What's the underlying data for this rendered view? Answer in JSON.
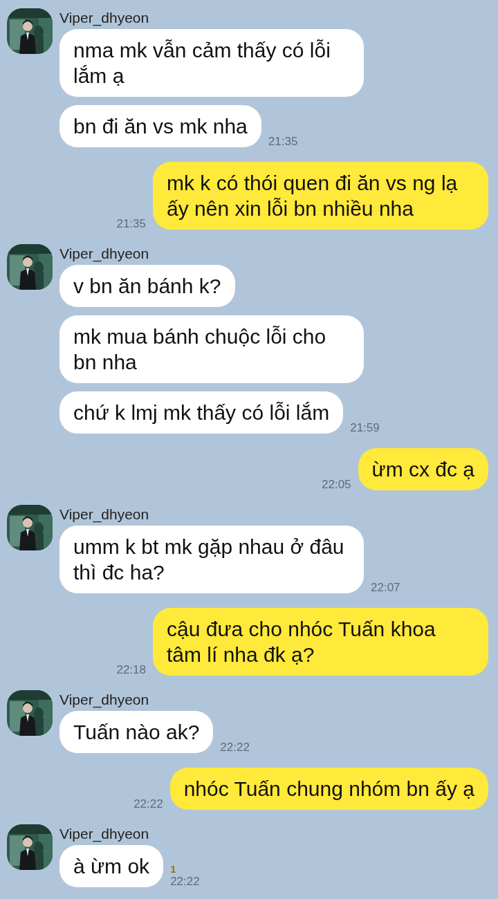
{
  "messages": [
    {
      "kind": "received",
      "sender": "Viper_dhyeon",
      "bubbles": [
        {
          "text": "nma mk vẫn cảm thấy có lỗi lắm ạ"
        },
        {
          "text": "bn đi ăn vs mk nha",
          "time": "21:35"
        }
      ]
    },
    {
      "kind": "sent",
      "bubbles": [
        {
          "text": "mk k có thói quen đi ăn vs ng lạ ấy nên xin lỗi bn nhiều nha",
          "time": "21:35"
        }
      ]
    },
    {
      "kind": "received",
      "sender": "Viper_dhyeon",
      "bubbles": [
        {
          "text": "v bn ăn bánh k?"
        },
        {
          "text": "mk mua bánh chuộc lỗi cho bn nha"
        },
        {
          "text": "chứ k lmj mk thấy có lỗi lắm",
          "time": "21:59"
        }
      ]
    },
    {
      "kind": "sent",
      "bubbles": [
        {
          "text": "ừm cx đc ạ",
          "time": "22:05"
        }
      ]
    },
    {
      "kind": "received",
      "sender": "Viper_dhyeon",
      "bubbles": [
        {
          "text": "umm k bt mk gặp nhau ở đâu thì đc ha?",
          "time": "22:07"
        }
      ]
    },
    {
      "kind": "sent",
      "bubbles": [
        {
          "text": "cậu đưa cho nhóc Tuấn khoa tâm lí nha đk ạ?",
          "time": "22:18"
        }
      ]
    },
    {
      "kind": "received",
      "sender": "Viper_dhyeon",
      "bubbles": [
        {
          "text": "Tuấn nào ak?",
          "time": "22:22"
        }
      ]
    },
    {
      "kind": "sent",
      "bubbles": [
        {
          "text": "nhóc Tuấn chung nhóm bn ấy ạ",
          "time": "22:22"
        }
      ]
    },
    {
      "kind": "received",
      "sender": "Viper_dhyeon",
      "bubbles": [
        {
          "text": "à ừm ok",
          "time": "22:22",
          "read_count": "1"
        }
      ]
    }
  ]
}
